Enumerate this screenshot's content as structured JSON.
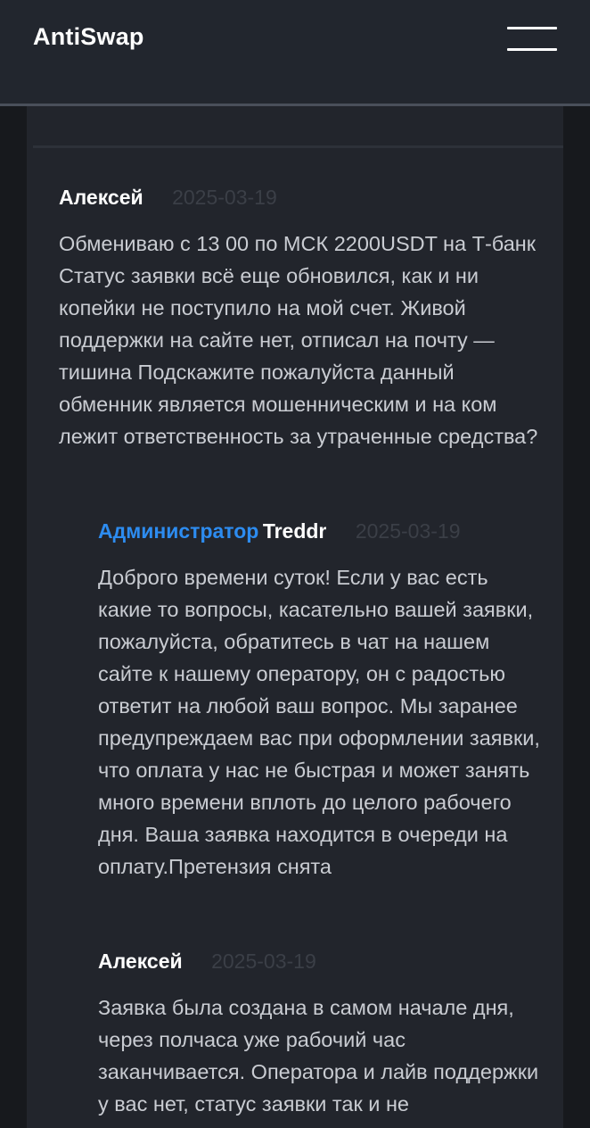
{
  "header": {
    "logo": "AntiSwap",
    "menu_icon": "hamburger-menu-icon"
  },
  "comments": [
    {
      "author": "Алексей",
      "date": "2025-03-19",
      "text": "Обмениваю с 13 00 по МСК 2200USDT на Т-банк Статус заявки всё еще обновился, как и ни копейки не поступило на мой счет. Живой поддержки на сайте нет, отписал на почту — тишина Подскажите пожалуйста данный обменник является мошенническим и на ком лежит ответственность за утраченные средства?"
    },
    {
      "role": "Администратор",
      "author": "Treddr",
      "date": "2025-03-19",
      "text": "Доброго времени суток! Если у вас есть какие то вопросы, касательно вашей заявки, пожалуйста, обратитесь в чат на нашем сайте к нашему оператору, он с радостью ответит на любой ваш вопрос. Мы заранее предупреждаем вас при оформлении заявки, что оплата у нас не быстрая и может занять много времени вплоть до целого рабочего дня. Ваша заявка находится в очереди на оплату.Претензия снята"
    },
    {
      "author": "Алексей",
      "date": "2025-03-19",
      "text": "Заявка была создана в самом начале дня, через полчаса уже рабочий час заканчивается. Оператора и лайв поддержки у вас нет, статус заявки так и не"
    }
  ],
  "colors": {
    "background": "#17191d",
    "header": "#22262e",
    "card": "#22252c",
    "admin_role": "#2d8cf0",
    "date": "#3b3f47",
    "text": "#c9ccd2"
  }
}
